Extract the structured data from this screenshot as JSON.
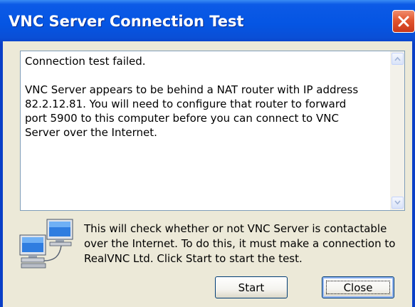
{
  "window": {
    "title": "VNC Server Connection Test"
  },
  "message": {
    "heading": "Connection test failed.",
    "body": "VNC Server appears to be behind a NAT router with IP address\n82.2.12.81. You will need to configure that router to forward\nport 5900 to this computer before you can connect to VNC\nServer over the Internet."
  },
  "info_text": "This will check whether or not VNC Server is contactable\nover the Internet. To do this, it must make a connection to\nRealVNC Ltd. Click Start to start the test.",
  "buttons": {
    "start_label": "Start",
    "close_label": "Close"
  },
  "icons": {
    "title_close": "close-icon",
    "scroll_up": "scroll-up-arrow-icon",
    "scroll_down": "scroll-down-arrow-icon",
    "network": "networked-computers-icon"
  },
  "colors": {
    "titlebar": "#0555e3",
    "close_button": "#e2552e",
    "dialog_background": "#ece9d8",
    "text_border": "#7f9db9"
  }
}
